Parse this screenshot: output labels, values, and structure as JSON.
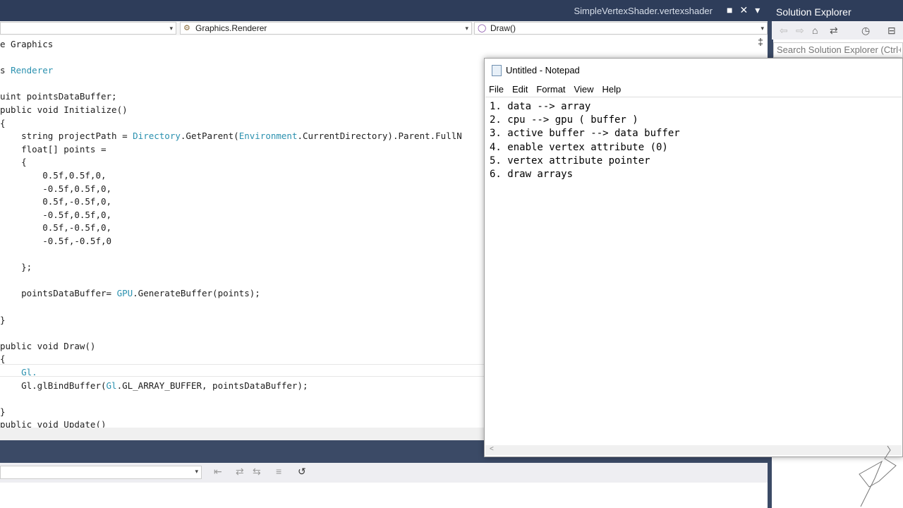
{
  "topbar": {
    "doc_tab": "SimpleVertexShader.vertexshader",
    "pin_glyph": "■",
    "close_glyph": "✕",
    "dropdown_glyph": "▾"
  },
  "navbar": {
    "project_dropdown": "",
    "class_dropdown": "Graphics.Renderer",
    "member_dropdown": "Draw()",
    "arrow": "▾"
  },
  "editor": {
    "split_glyph": "‡",
    "lines": [
      {
        "parts": [
          {
            "t": "e Graphics",
            "c": "k"
          }
        ]
      },
      {
        "parts": []
      },
      {
        "parts": [
          {
            "t": "s ",
            "c": "k"
          },
          {
            "t": "Renderer",
            "c": "t"
          }
        ]
      },
      {
        "parts": []
      },
      {
        "parts": [
          {
            "t": "uint pointsDataBuffer;",
            "c": "k"
          }
        ]
      },
      {
        "parts": [
          {
            "t": "public void Initialize()",
            "c": "k"
          }
        ]
      },
      {
        "parts": [
          {
            "t": "{",
            "c": "k"
          }
        ]
      },
      {
        "parts": [
          {
            "t": "    string projectPath = ",
            "c": "k"
          },
          {
            "t": "Directory",
            "c": "t"
          },
          {
            "t": ".GetParent(",
            "c": "k"
          },
          {
            "t": "Environment",
            "c": "t"
          },
          {
            "t": ".CurrentDirectory).Parent.FullN",
            "c": "k"
          }
        ]
      },
      {
        "parts": [
          {
            "t": "    float[] points =",
            "c": "k"
          }
        ]
      },
      {
        "parts": [
          {
            "t": "    {",
            "c": "k"
          }
        ]
      },
      {
        "parts": [
          {
            "t": "        0.5f,0.5f,0,",
            "c": "k"
          }
        ]
      },
      {
        "parts": [
          {
            "t": "        -0.5f,0.5f,0,",
            "c": "k"
          }
        ]
      },
      {
        "parts": [
          {
            "t": "        0.5f,-0.5f,0,",
            "c": "k"
          }
        ]
      },
      {
        "parts": [
          {
            "t": "        -0.5f,0.5f,0,",
            "c": "k"
          }
        ]
      },
      {
        "parts": [
          {
            "t": "        0.5f,-0.5f,0,",
            "c": "k"
          }
        ]
      },
      {
        "parts": [
          {
            "t": "        -0.5f,-0.5f,0",
            "c": "k"
          }
        ]
      },
      {
        "parts": []
      },
      {
        "parts": [
          {
            "t": "    };",
            "c": "k"
          }
        ]
      },
      {
        "parts": []
      },
      {
        "parts": [
          {
            "t": "    pointsDataBuffer= ",
            "c": "k"
          },
          {
            "t": "GPU",
            "c": "t"
          },
          {
            "t": ".GenerateBuffer(points);",
            "c": "k"
          }
        ]
      },
      {
        "parts": []
      },
      {
        "parts": [
          {
            "t": "}",
            "c": "k"
          }
        ]
      },
      {
        "parts": []
      },
      {
        "parts": [
          {
            "t": "public void Draw()",
            "c": "k"
          }
        ]
      },
      {
        "parts": [
          {
            "t": "{",
            "c": "k"
          }
        ]
      },
      {
        "parts": [
          {
            "t": "    ",
            "c": "k"
          },
          {
            "t": "Gl.",
            "c": "t"
          }
        ]
      },
      {
        "parts": [
          {
            "t": "    Gl.glBindBuffer(",
            "c": "k"
          },
          {
            "t": "Gl",
            "c": "t"
          },
          {
            "t": ".GL_ARRAY_BUFFER, pointsDataBuffer);",
            "c": "k"
          }
        ]
      },
      {
        "parts": []
      },
      {
        "parts": [
          {
            "t": "}",
            "c": "k"
          }
        ]
      },
      {
        "parts": [
          {
            "t": "public void Update()",
            "c": "k"
          }
        ]
      }
    ]
  },
  "solution_explorer": {
    "title": "Solution Explorer",
    "search_placeholder": "Search Solution Explorer (Ctrl+;)",
    "icons": [
      "back-icon",
      "forward-icon",
      "home-icon",
      "sync-icon",
      "history-icon",
      "collapse-icon"
    ]
  },
  "notepad": {
    "title": "Untitled - Notepad",
    "menu": [
      "File",
      "Edit",
      "Format",
      "View",
      "Help"
    ],
    "lines": [
      "1. data --> array",
      "2. cpu --> gpu ( buffer )",
      "3. active buffer --> data buffer",
      "4. enable vertex attribute (0)",
      "5. vertex attribute pointer",
      "6. draw arrays"
    ],
    "scroll_left": "<"
  },
  "colors": {
    "title_bar": "#2e3d5a",
    "type_name": "#2b91af",
    "code_text": "#1e1e1e"
  }
}
